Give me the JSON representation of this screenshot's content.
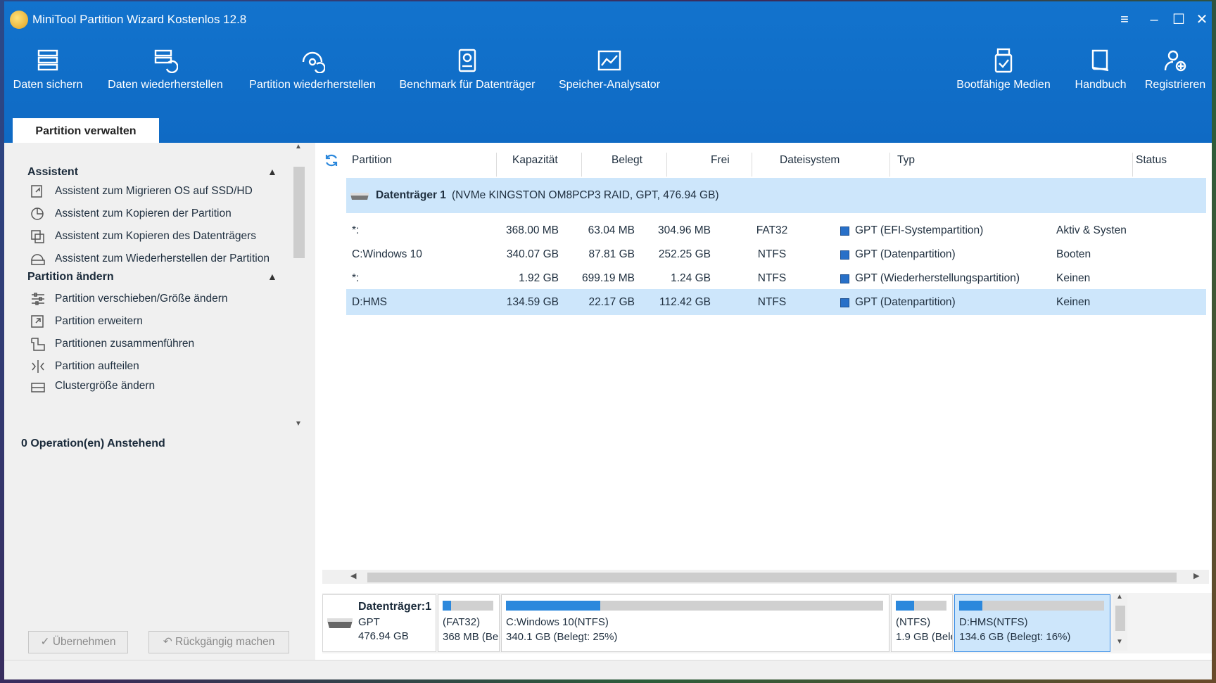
{
  "app": {
    "title": "MiniTool Partition Wizard Kostenlos 12.8"
  },
  "toolbar": {
    "items": [
      {
        "label": "Daten sichern",
        "icon": "backup-icon"
      },
      {
        "label": "Daten wiederherstellen",
        "icon": "data-recovery-icon"
      },
      {
        "label": "Partition wiederherstellen",
        "icon": "partition-recovery-icon"
      },
      {
        "label": "Benchmark für Datenträger",
        "icon": "benchmark-icon"
      },
      {
        "label": "Speicher-Analysator",
        "icon": "space-analyzer-icon"
      },
      {
        "label": "Bootfähige Medien",
        "icon": "bootable-media-icon"
      },
      {
        "label": "Handbuch",
        "icon": "manual-icon"
      },
      {
        "label": "Registrieren",
        "icon": "register-icon"
      }
    ]
  },
  "tabs": {
    "active": "Partition verwalten"
  },
  "sidebar": {
    "sections": [
      {
        "title": "Assistent",
        "items": [
          "Assistent zum Migrieren OS auf SSD/HD",
          "Assistent zum Kopieren der Partition",
          "Assistent zum Kopieren des Datenträgers",
          "Assistent zum Wiederherstellen der Partition"
        ]
      },
      {
        "title": "Partition ändern",
        "items": [
          "Partition verschieben/Größe ändern",
          "Partition erweitern",
          "Partitionen zusammenführen",
          "Partition aufteilen",
          "Clustergröße ändern"
        ]
      }
    ],
    "pending": "0 Operation(en) Anstehend",
    "apply_label": "Übernehmen",
    "undo_label": "Rückgängig machen"
  },
  "table": {
    "columns": [
      "Partition",
      "Kapazität",
      "Belegt",
      "Frei",
      "Dateisystem",
      "Typ",
      "Status"
    ],
    "disk": {
      "name": "Datenträger 1",
      "details": "(NVMe KINGSTON OM8PCP3 RAID, GPT, 476.94 GB)"
    },
    "rows": [
      {
        "partition": "*:",
        "capacity": "368.00 MB",
        "used": "63.04 MB",
        "free": "304.96 MB",
        "fs": "FAT32",
        "type": "GPT (EFI-Systempartition)",
        "status": "Aktiv & Systen"
      },
      {
        "partition": "C:Windows 10",
        "capacity": "340.07 GB",
        "used": "87.81 GB",
        "free": "252.25 GB",
        "fs": "NTFS",
        "type": "GPT (Datenpartition)",
        "status": "Booten"
      },
      {
        "partition": "*:",
        "capacity": "1.92 GB",
        "used": "699.19 MB",
        "free": "1.24 GB",
        "fs": "NTFS",
        "type": "GPT (Wiederherstellungspartition)",
        "status": "Keinen"
      },
      {
        "partition": "D:HMS",
        "capacity": "134.59 GB",
        "used": "22.17 GB",
        "free": "112.42 GB",
        "fs": "NTFS",
        "type": "GPT (Datenpartition)",
        "status": "Keinen"
      }
    ]
  },
  "diskmap": {
    "disk_name": "Datenträger:1",
    "disk_style": "GPT",
    "disk_size": "476.94 GB",
    "partitions": [
      {
        "line1": "(FAT32)",
        "line2": "368 MB (Bel",
        "used_fraction": 0.17
      },
      {
        "line1": "C:Windows 10(NTFS)",
        "line2": "340.1 GB (Belegt: 25%)",
        "used_fraction": 0.25
      },
      {
        "line1": "(NTFS)",
        "line2": "1.9 GB (Bele",
        "used_fraction": 0.36
      },
      {
        "line1": "D:HMS(NTFS)",
        "line2": "134.6 GB (Belegt: 16%)",
        "used_fraction": 0.16
      }
    ]
  },
  "colors": {
    "header": "#1273cd",
    "selection": "#cde6fb",
    "used_bar": "#2c88dc"
  }
}
